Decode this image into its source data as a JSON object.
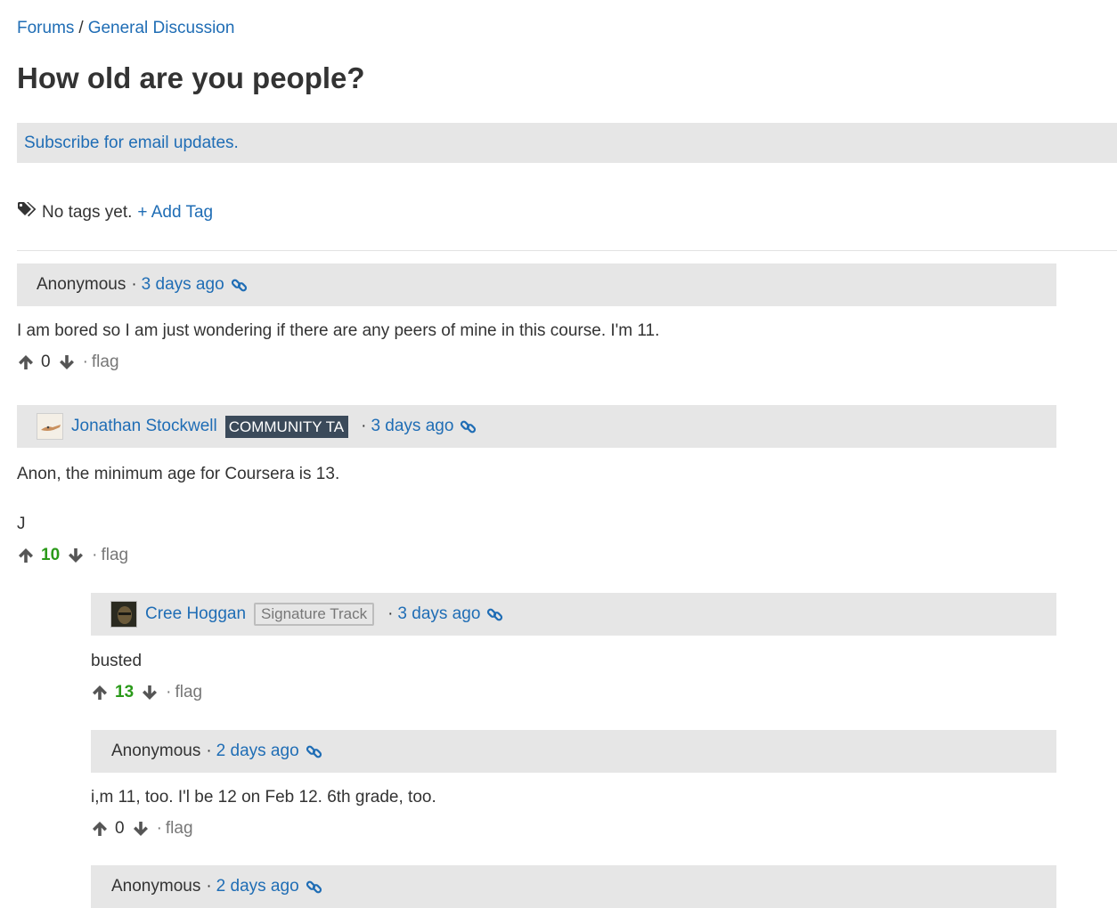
{
  "breadcrumb": {
    "forums": "Forums",
    "separator": "/",
    "category": "General Discussion"
  },
  "thread": {
    "title": "How old are you people?"
  },
  "subscribe": {
    "label": "Subscribe for email updates."
  },
  "tags": {
    "empty_text": "No tags yet.",
    "add_label": "+ Add Tag"
  },
  "posts": [
    {
      "author": "Anonymous",
      "dot": "·",
      "time": "3 days ago",
      "body": [
        "I am bored so I am just wondering if there are any peers of mine in this course. I'm 11."
      ],
      "votes": "0",
      "flag": "flag"
    },
    {
      "author": "Jonathan Stockwell",
      "badge": "COMMUNITY TA",
      "dot": "·",
      "time": "3 days ago",
      "body": [
        "Anon, the minimum age for Coursera is 13.",
        "J"
      ],
      "votes": "10",
      "flag": "flag"
    },
    {
      "author": "Cree Hoggan",
      "badge": "Signature Track",
      "dot": "·",
      "time": "3 days ago",
      "body": [
        "busted"
      ],
      "votes": "13",
      "flag": "flag"
    },
    {
      "author": "Anonymous",
      "dot": "·",
      "time": "2 days ago",
      "body": [
        "i,m 11, too. I'l be 12 on Feb 12. 6th grade, too."
      ],
      "votes": "0",
      "flag": "flag"
    },
    {
      "author": "Anonymous",
      "dot": "·",
      "time": "2 days ago"
    }
  ],
  "vote_separator": "·",
  "icons": {
    "tags": "tags-icon",
    "permalink": "link-icon",
    "upvote": "arrow-up-icon",
    "downvote": "arrow-down-icon"
  },
  "colors": {
    "link": "#1f6db5",
    "header_bg": "#e6e6e6",
    "positive_votes": "#2b9a1a",
    "ta_badge": "#3b4a5a"
  }
}
